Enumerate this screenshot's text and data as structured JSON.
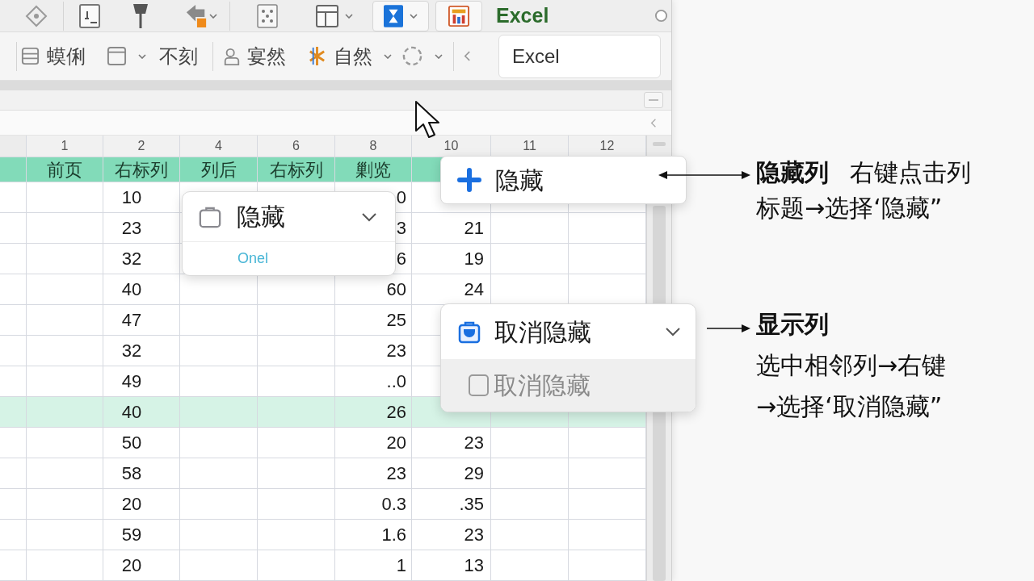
{
  "app_bar": {
    "label": "Excel"
  },
  "toolbar": {
    "items": [
      {
        "kind": "button",
        "label": "蟆俐"
      },
      {
        "kind": "dropdown"
      },
      {
        "kind": "text",
        "label": "不刻"
      },
      {
        "kind": "separator"
      },
      {
        "kind": "button",
        "label": "宴然"
      },
      {
        "kind": "dropdown",
        "label": "自然"
      },
      {
        "kind": "dropdown"
      },
      {
        "kind": "separator"
      },
      {
        "kind": "back"
      }
    ],
    "name_box": {
      "value": "Excel"
    }
  },
  "sheet": {
    "columns": [
      "1",
      "2",
      "4",
      "6",
      "8",
      "10",
      "11",
      "12"
    ],
    "rows": [
      {
        "kind": "header",
        "selected": false,
        "cells": [
          "前页",
          "右标列",
          "列后",
          "右标列",
          "剿览",
          null,
          null,
          null
        ]
      },
      {
        "kind": "data",
        "selected": false,
        "cells": [
          null,
          "10",
          null,
          null,
          "0",
          null,
          null,
          null
        ]
      },
      {
        "kind": "data",
        "selected": false,
        "cells": [
          null,
          "23",
          null,
          null,
          "3",
          "21",
          null,
          null
        ]
      },
      {
        "kind": "data",
        "selected": false,
        "cells": [
          null,
          "32",
          null,
          null,
          "6",
          "19",
          null,
          null
        ]
      },
      {
        "kind": "data",
        "selected": false,
        "cells": [
          null,
          "40",
          null,
          null,
          "60",
          "24",
          null,
          null
        ]
      },
      {
        "kind": "data",
        "selected": false,
        "cells": [
          null,
          "47",
          null,
          null,
          "25",
          null,
          null,
          null
        ]
      },
      {
        "kind": "data",
        "selected": false,
        "cells": [
          null,
          "32",
          null,
          null,
          "23",
          null,
          null,
          null
        ]
      },
      {
        "kind": "data",
        "selected": false,
        "cells": [
          null,
          "49",
          null,
          null,
          "..0",
          null,
          null,
          null
        ]
      },
      {
        "kind": "data",
        "selected": true,
        "cells": [
          null,
          "40",
          null,
          null,
          "26",
          null,
          null,
          null
        ]
      },
      {
        "kind": "data",
        "selected": false,
        "cells": [
          null,
          "50",
          null,
          null,
          "20",
          "23",
          null,
          null
        ]
      },
      {
        "kind": "data",
        "selected": false,
        "cells": [
          null,
          "58",
          null,
          null,
          "23",
          "29",
          null,
          null
        ]
      },
      {
        "kind": "data",
        "selected": false,
        "cells": [
          null,
          "20",
          null,
          null,
          "0.3",
          ".35",
          null,
          null
        ]
      },
      {
        "kind": "data",
        "selected": false,
        "cells": [
          null,
          "59",
          null,
          null,
          "1.6",
          "23",
          null,
          null
        ]
      },
      {
        "kind": "data",
        "selected": false,
        "cells": [
          null,
          "20",
          null,
          null,
          "1",
          "13",
          null,
          null
        ]
      }
    ]
  },
  "hide_dropdown": {
    "title": "隐藏",
    "option": "Onel"
  },
  "hide_item": {
    "label": "隐藏"
  },
  "unhide_menu": {
    "title": "取消隐藏",
    "option": {
      "label": "取消隐藏",
      "checked": false,
      "disabled": true
    }
  },
  "annotations": [
    {
      "kind": "inline",
      "title": "隐藏列",
      "text": "右键点击列标题→选择‘隐藏”"
    },
    {
      "kind": "stacked",
      "title": "显示列",
      "text": "选中相邻列→右键→选择‘取消隐藏”"
    }
  ]
}
